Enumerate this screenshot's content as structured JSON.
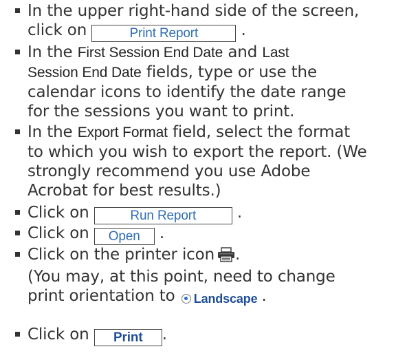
{
  "instructions": [
    {
      "pre": "In the upper right-hand side of the screen,",
      "line2_pre": "click on",
      "button": "Print Report",
      "post": "."
    },
    {
      "l1_a": "In the",
      "l1_term1": "First Session End Date",
      "l1_b": "and",
      "l1_term2": "Last",
      "l2_term2_cont": "Session End Date",
      "l2_b": "fields, type or use the",
      "l3": "calendar icons to identify the date range",
      "l4": "for the sessions you want to print."
    },
    {
      "l1_a": "In the",
      "l1_term": "Export Format",
      "l1_b": "field, select the format",
      "l2": "to which you wish to export the report. (We",
      "l3": "strongly recommend you use Adobe",
      "l4": "Acrobat for best results.)"
    },
    {
      "pre": "Click on",
      "button": "Run Report",
      "post": "."
    },
    {
      "pre": "Click on",
      "button": "Open",
      "post": "."
    },
    {
      "l1": "Click on the printer icon",
      "l1_post": ".",
      "icon": "printer-icon",
      "l2": "(You may, at this point, need to change",
      "l3_pre": "print orientation to",
      "radio_label": "Landscape",
      "l3_post": "."
    },
    {
      "pre": "Click on",
      "button": "Print",
      "post": "."
    }
  ]
}
